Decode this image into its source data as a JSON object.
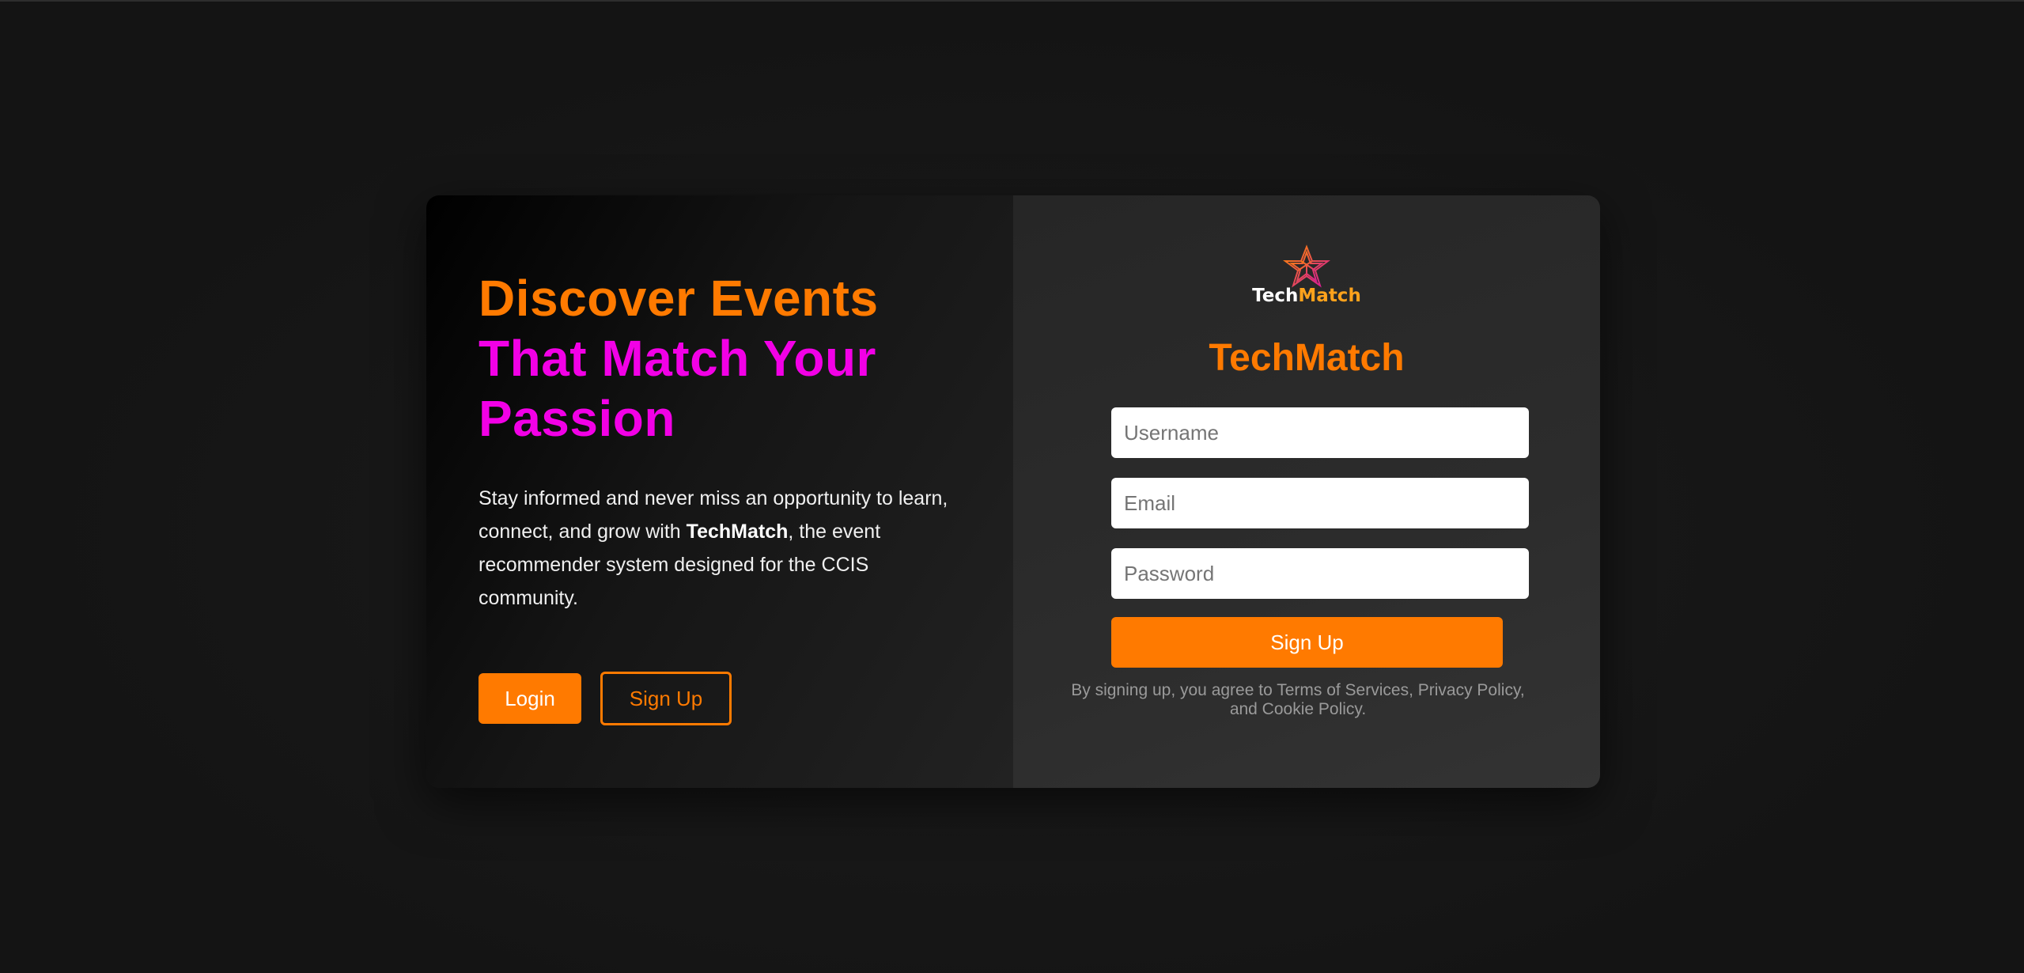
{
  "hero": {
    "headline_line1": "Discover Events",
    "headline_line2": "That Match Your",
    "headline_line3": "Passion",
    "desc_before": "Stay informed and never miss an opportunity to learn, connect, and grow with ",
    "desc_brand": "TechMatch",
    "desc_after": ", the event recommender system designed for the CCIS community.",
    "login_label": "Login",
    "signup_label": "Sign Up"
  },
  "signup_panel": {
    "logo_tech": "Tech",
    "logo_match": "Match",
    "logo_icon": "star-knot-icon",
    "title": "TechMatch",
    "username_placeholder": "Username",
    "email_placeholder": "Email",
    "password_placeholder": "Password",
    "submit_label": "Sign Up",
    "terms": "By signing up, you agree to Terms of Services, Privacy Policy, and Cookie Policy."
  },
  "colors": {
    "accent_orange": "#ff7a00",
    "accent_magenta": "#f200e6",
    "logo_match": "#ffa21c"
  }
}
